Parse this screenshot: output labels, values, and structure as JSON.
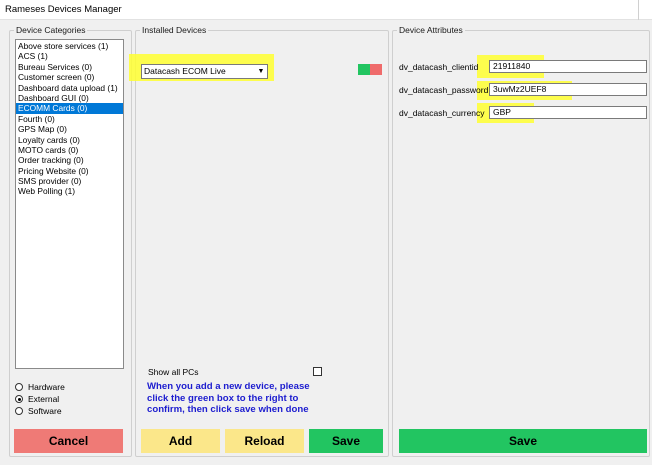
{
  "window": {
    "title": "Rameses  Devices Manager"
  },
  "categories": {
    "title": "Device Categories",
    "items": [
      "Above store services (1)",
      "ACS (1)",
      "Bureau Services (0)",
      "Customer screen (0)",
      "Dashboard data upload (1)",
      "Dashboard GUI (0)",
      "ECOMM Cards (0)",
      "Fourth (0)",
      "GPS Map (0)",
      "Loyalty cards (0)",
      "MOTO cards (0)",
      "Order tracking (0)",
      "Pricing Website (0)",
      "SMS provider (0)",
      "Web Polling (1)"
    ],
    "selected_index": 6,
    "radio": {
      "hardware": "Hardware",
      "external": "External",
      "software": "Software",
      "selected": "External"
    },
    "cancel_label": "Cancel"
  },
  "installed": {
    "title": "Installed Devices",
    "device_select": "Datacash ECOM Live",
    "show_all_label": "Show all PCs",
    "info_line1": "When you add a new device, please",
    "info_line2": "click the green box to the right to",
    "info_line3": "confirm, then click save when done",
    "add_label": "Add",
    "reload_label": "Reload",
    "save_label": "Save"
  },
  "attributes": {
    "title": "Device Attributes",
    "fields": [
      {
        "label": "dv_datacash_clientid",
        "value": "21911840"
      },
      {
        "label": "dv_datacash_password",
        "value": "3uwMz2UEF8"
      },
      {
        "label": "dv_datacash_currency",
        "value": "GBP"
      }
    ],
    "save_label": "Save"
  },
  "colors": {
    "cancel": "#ef7a76",
    "add": "#fbe78a",
    "save": "#22c561",
    "selection": "#0078d7",
    "highlight": "#ffff30",
    "info_text": "#1c1ccf",
    "status_green": "#22c561",
    "status_red": "#ef6b6b"
  }
}
